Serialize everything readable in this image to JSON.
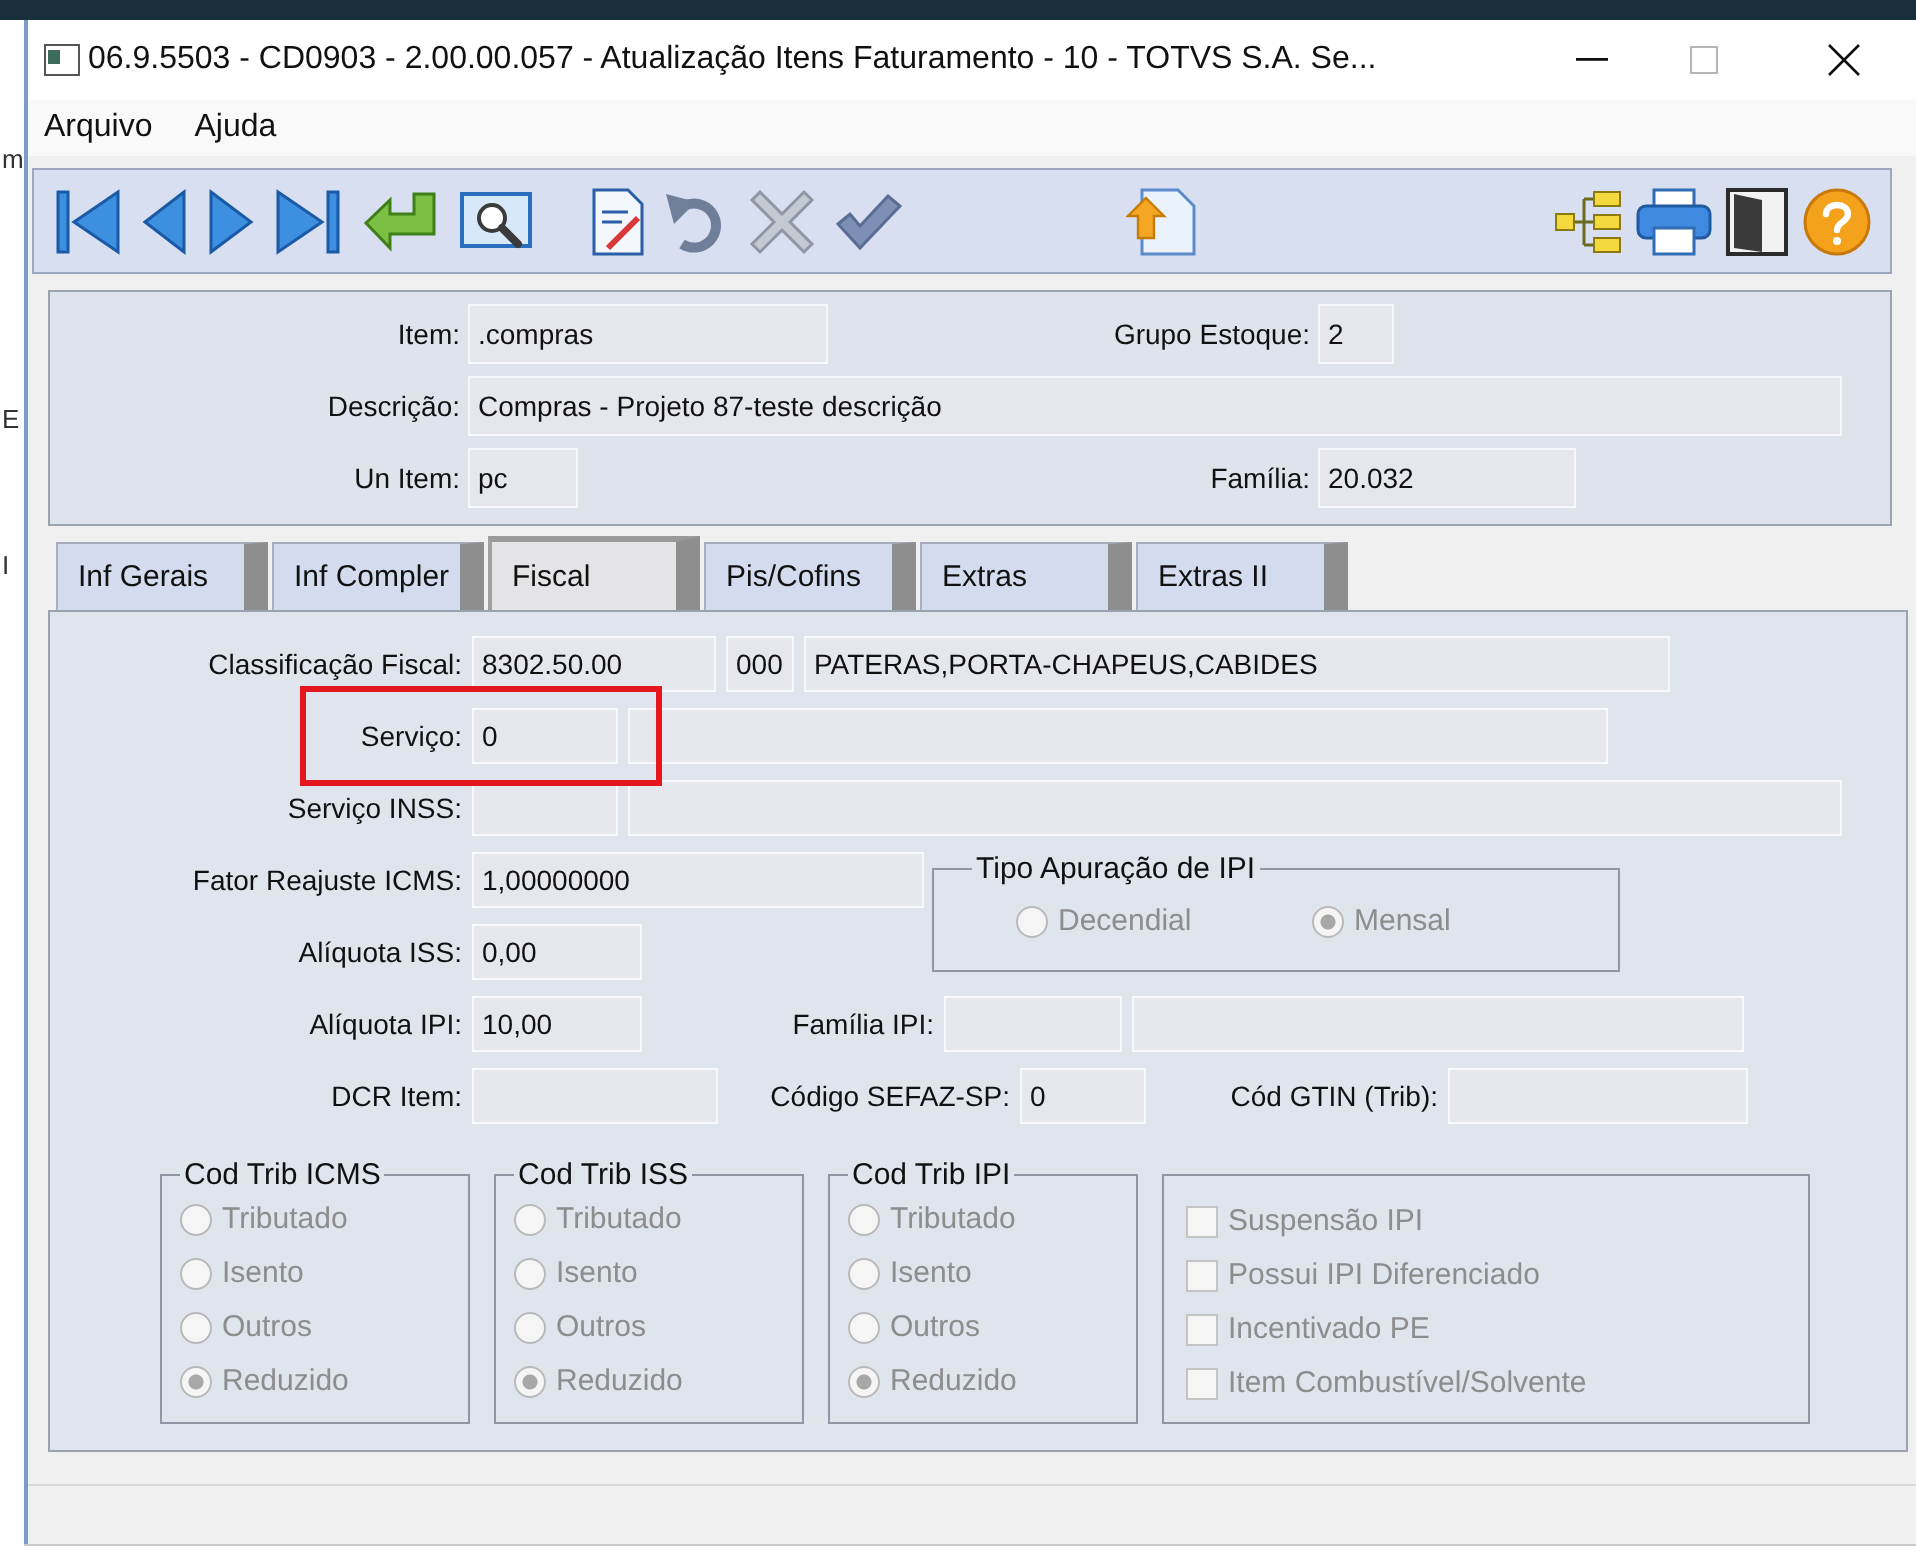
{
  "background_app": {
    "texts": [
      "m",
      "E",
      "I"
    ]
  },
  "window": {
    "title": "06.9.5503 - CD0903 - 2.00.00.057 - Atualização Itens Faturamento - 10 - TOTVS S.A. Se...",
    "menu": [
      "Arquivo",
      "Ajuda"
    ]
  },
  "header": {
    "rows": [
      [
        {
          "label": "Item:",
          "value": ".compras"
        },
        {
          "label": "Grupo Estoque:",
          "value": "2"
        }
      ],
      [
        {
          "label": "Descrição:",
          "value": "Compras - Projeto 87-teste descrição"
        }
      ],
      [
        {
          "label": "Un Item:",
          "value": "pc"
        },
        {
          "label": "Família:",
          "value": "20.032"
        }
      ]
    ]
  },
  "tabs": [
    {
      "label": "Inf Gerais",
      "selected": false
    },
    {
      "label": "Inf Compler",
      "selected": false
    },
    {
      "label": "Fiscal",
      "selected": true
    },
    {
      "label": "Pis/Cofins",
      "selected": false
    },
    {
      "label": "Extras",
      "selected": false
    },
    {
      "label": "Extras II",
      "selected": false
    }
  ],
  "fiscal": {
    "rows": [
      {
        "highlighted": false,
        "pairs": [
          {
            "label": "Classificação Fiscal:",
            "fields": [
              {
                "kind": "text",
                "value": "8302.50.00"
              },
              {
                "kind": "text",
                "value": "000"
              },
              {
                "kind": "text",
                "value": "PATERAS,PORTA-CHAPEUS,CABIDES"
              }
            ]
          }
        ]
      },
      {
        "highlighted": true,
        "pairs": [
          {
            "label": "Serviço:",
            "fields": [
              {
                "kind": "text",
                "value": "0"
              },
              {
                "kind": "empty"
              }
            ]
          }
        ]
      },
      {
        "highlighted": false,
        "pairs": [
          {
            "label": "Serviço INSS:",
            "fields": [
              {
                "kind": "empty"
              },
              {
                "kind": "empty"
              }
            ]
          }
        ]
      },
      {
        "highlighted": false,
        "pairs": [
          {
            "label": "Fator Reajuste ICMS:",
            "fields": [
              {
                "kind": "text",
                "value": "1,00000000"
              }
            ]
          }
        ]
      },
      {
        "highlighted": false,
        "pairs": [
          {
            "label": "Alíquota ISS:",
            "fields": [
              {
                "kind": "text",
                "value": "0,00"
              }
            ]
          }
        ]
      },
      {
        "highlighted": false,
        "pairs": [
          {
            "label": "Alíquota IPI:",
            "fields": [
              {
                "kind": "text",
                "value": "10,00"
              }
            ]
          },
          {
            "label": "Família IPI:",
            "fields": [
              {
                "kind": "empty"
              },
              {
                "kind": "empty"
              }
            ]
          }
        ]
      },
      {
        "highlighted": false,
        "pairs": [
          {
            "label": "DCR Item:",
            "fields": [
              {
                "kind": "empty"
              }
            ]
          },
          {
            "label": "Código SEFAZ-SP:",
            "fields": [
              {
                "kind": "text",
                "value": "0"
              }
            ]
          },
          {
            "label": "Cód GTIN (Trib):",
            "fields": [
              {
                "kind": "empty"
              }
            ]
          }
        ]
      }
    ],
    "ipi_period": {
      "title": "Tipo Apuração de IPI",
      "disabled": true,
      "options": [
        {
          "label": "Decendial",
          "selected": false
        },
        {
          "label": "Mensal",
          "selected": true
        }
      ]
    },
    "tax_groups": [
      {
        "title": "Cod Trib ICMS",
        "disabled": true,
        "options": [
          {
            "label": "Tributado",
            "selected": false
          },
          {
            "label": "Isento",
            "selected": false
          },
          {
            "label": "Outros",
            "selected": false
          },
          {
            "label": "Reduzido",
            "selected": true
          }
        ]
      },
      {
        "title": "Cod Trib ISS",
        "disabled": true,
        "options": [
          {
            "label": "Tributado",
            "selected": false
          },
          {
            "label": "Isento",
            "selected": false
          },
          {
            "label": "Outros",
            "selected": false
          },
          {
            "label": "Reduzido",
            "selected": true
          }
        ]
      },
      {
        "title": "Cod Trib IPI",
        "disabled": true,
        "options": [
          {
            "label": "Tributado",
            "selected": false
          },
          {
            "label": "Isento",
            "selected": false
          },
          {
            "label": "Outros",
            "selected": false
          },
          {
            "label": "Reduzido",
            "selected": true
          }
        ]
      }
    ],
    "flags": {
      "disabled": true,
      "options": [
        {
          "label": "Suspensão IPI",
          "checked": false
        },
        {
          "label": "Possui IPI Diferenciado",
          "checked": false
        },
        {
          "label": "Incentivado PE",
          "checked": false
        },
        {
          "label": "Item Combustível/Solvente",
          "checked": false
        }
      ]
    }
  }
}
